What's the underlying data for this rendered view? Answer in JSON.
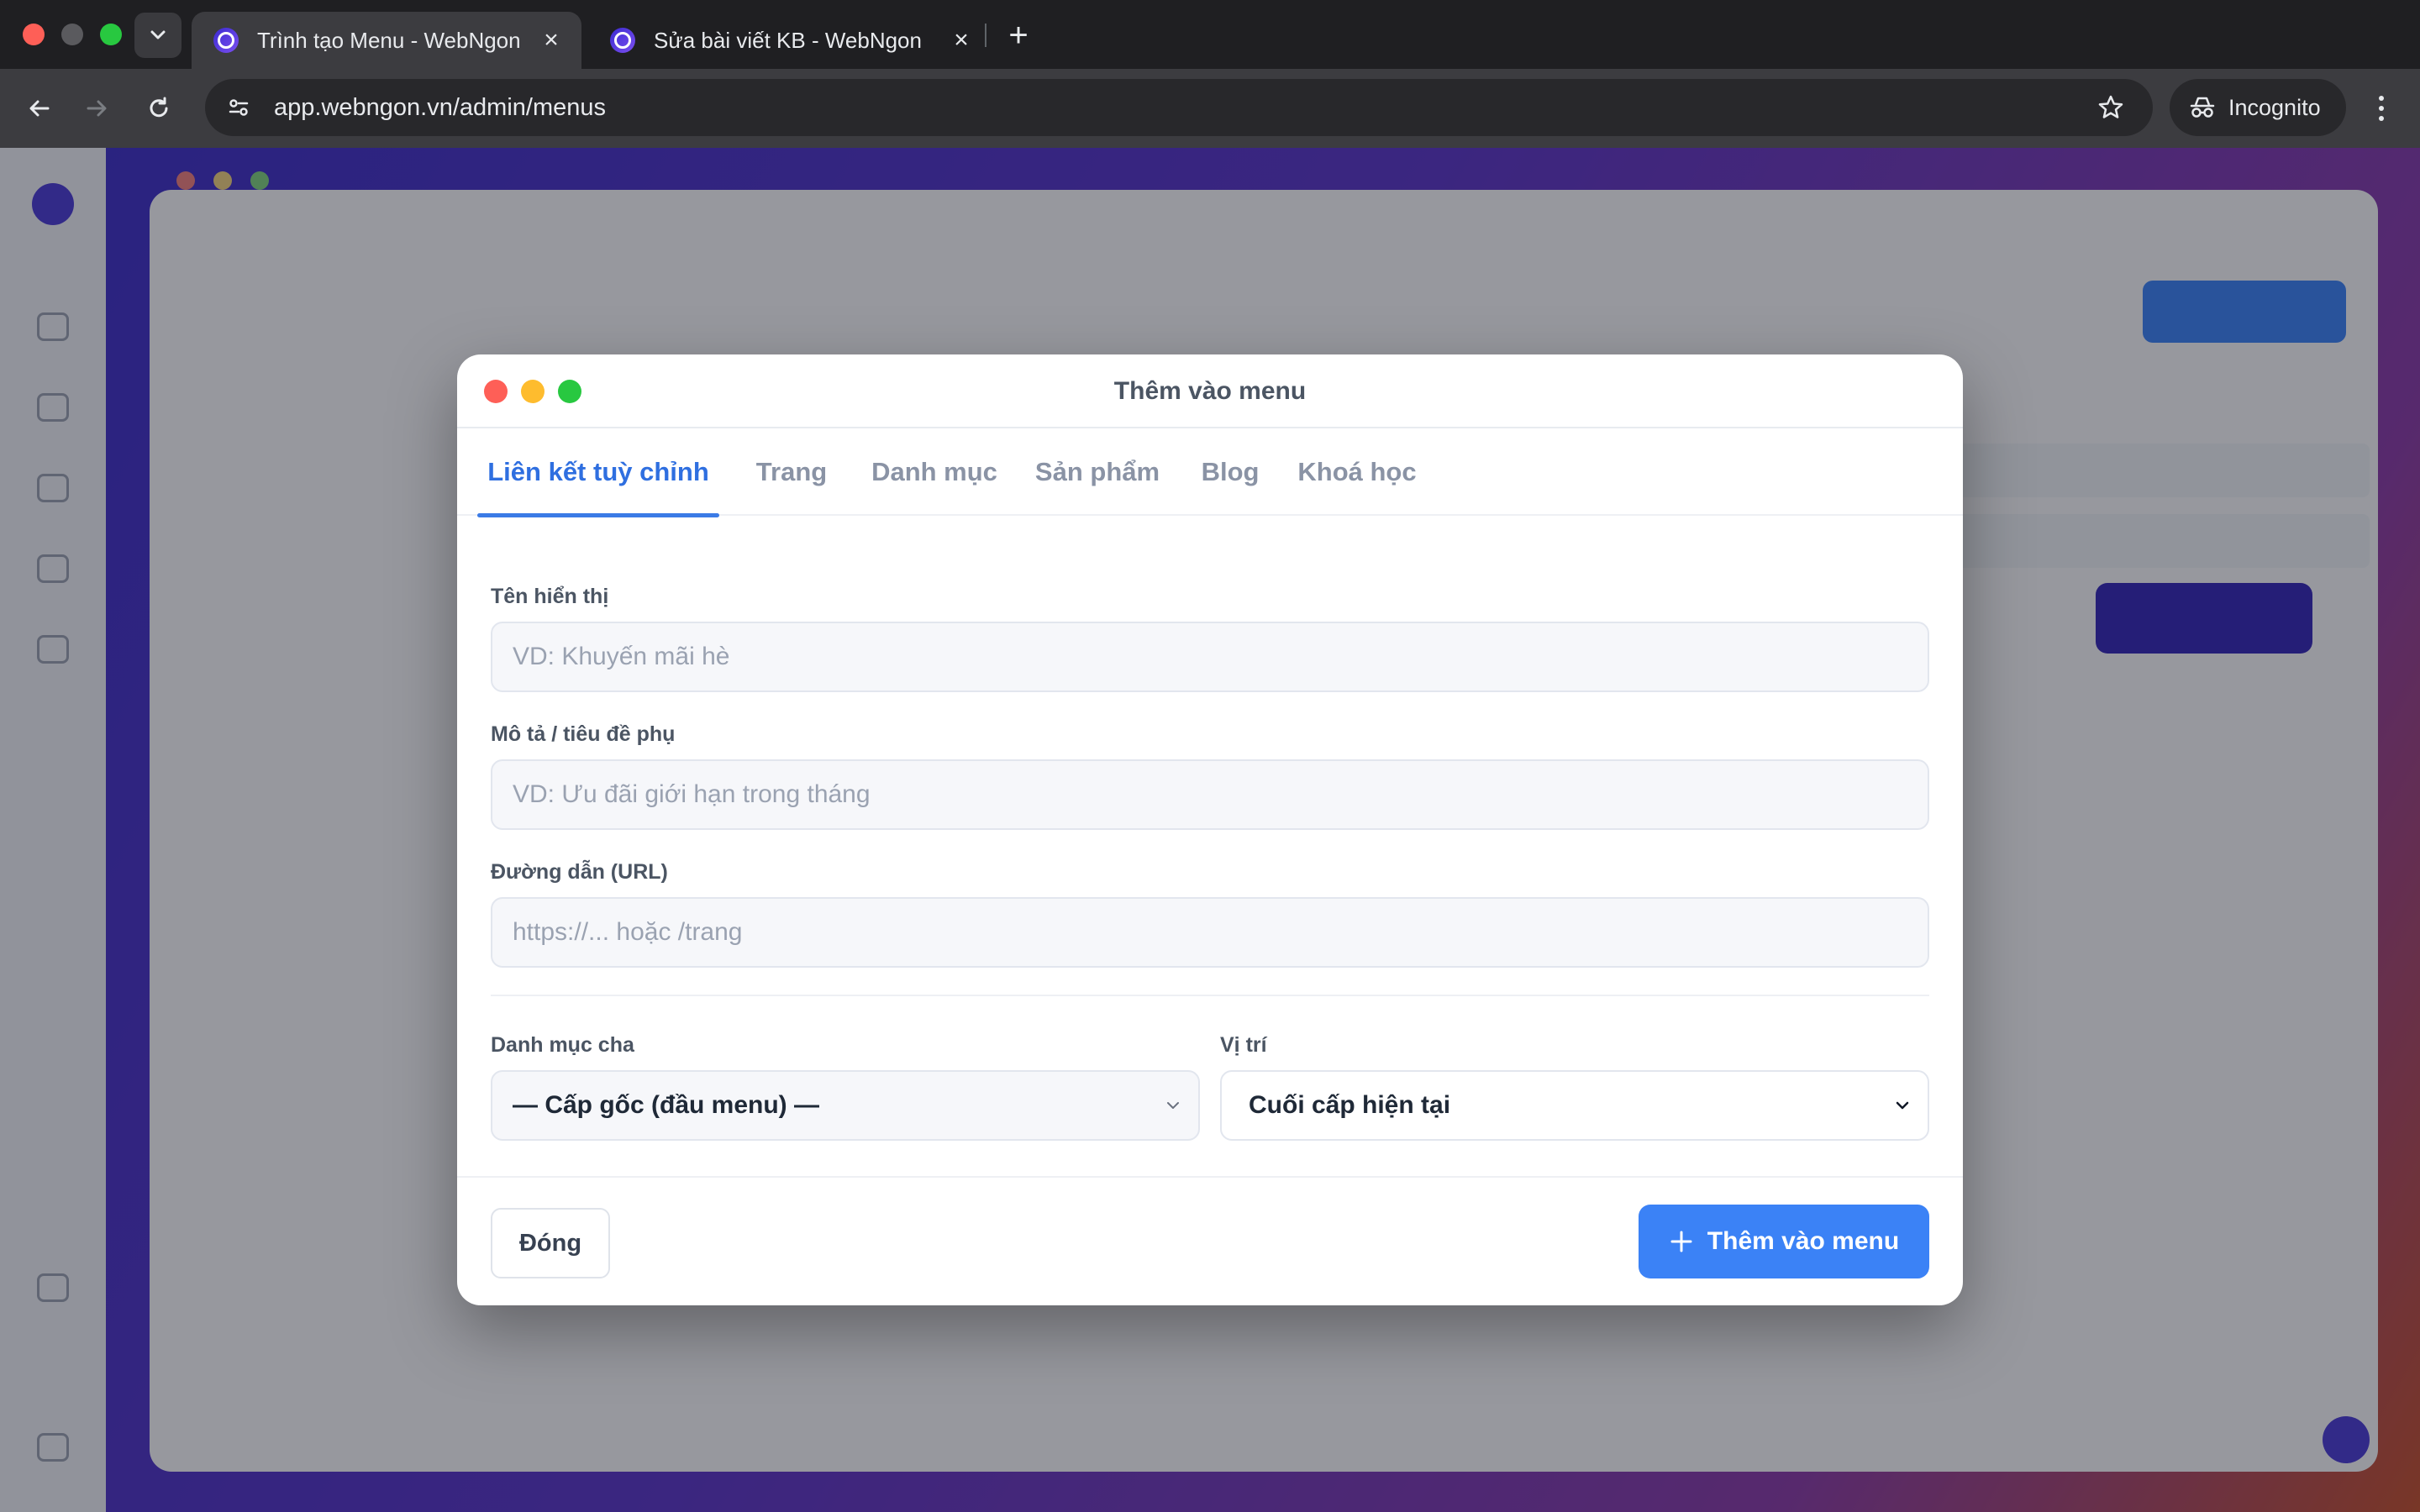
{
  "browser": {
    "tabs": [
      {
        "title": "Trình tạo Menu - WebNgon",
        "active": true
      },
      {
        "title": "Sửa bài viết KB - WebNgon",
        "active": false
      }
    ],
    "url": "app.webngon.vn/admin/menus",
    "incognito_label": "Incognito"
  },
  "modal": {
    "title": "Thêm vào menu",
    "tabs": [
      {
        "label": "Liên kết tuỳ chỉnh",
        "active": true
      },
      {
        "label": "Trang",
        "active": false
      },
      {
        "label": "Danh mục",
        "active": false
      },
      {
        "label": "Sản phẩm",
        "active": false
      },
      {
        "label": "Blog",
        "active": false
      },
      {
        "label": "Khoá học",
        "active": false
      }
    ],
    "fields": {
      "display_name": {
        "label": "Tên hiển thị",
        "value": "",
        "placeholder": "VD: Khuyến mãi hè"
      },
      "description": {
        "label": "Mô tả / tiêu đề phụ",
        "value": "",
        "placeholder": "VD: Ưu đãi giới hạn trong tháng"
      },
      "url": {
        "label": "Đường dẫn (URL)",
        "value": "",
        "placeholder": "https://... hoặc /trang"
      },
      "parent": {
        "label": "Danh mục cha",
        "selected": "— Cấp gốc (đầu menu) —"
      },
      "position": {
        "label": "Vị trí",
        "selected": "Cuối cấp hiện tại"
      }
    },
    "buttons": {
      "close": "Đóng",
      "add": "Thêm vào menu"
    }
  },
  "colors": {
    "accent": "#3b82f6",
    "tab_active": "#2f6fe0",
    "overlay": "rgba(16,18,28,0.42)"
  }
}
